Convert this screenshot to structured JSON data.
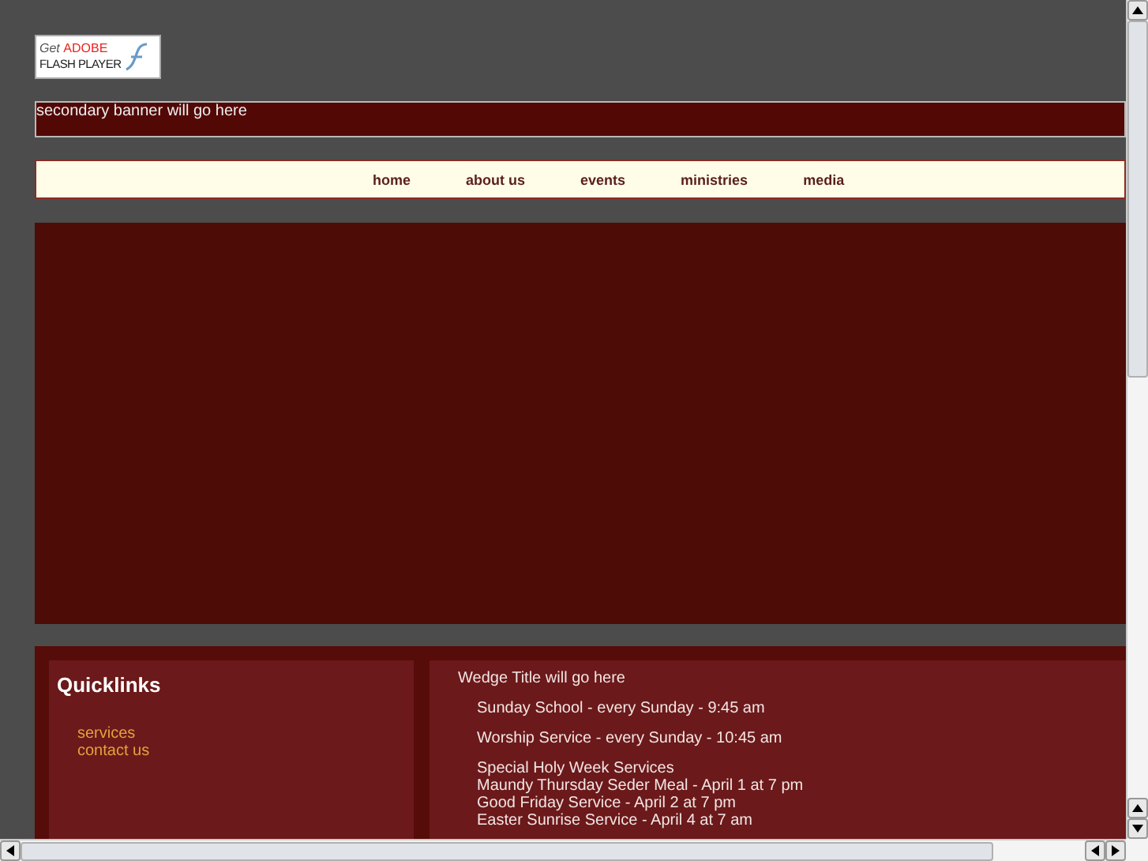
{
  "flash_badge": {
    "line_1_prefix": "Get",
    "line_1_brand": "ADOBE",
    "line_2": "FLASH PLAYER"
  },
  "secondary_banner": {
    "text": "secondary banner will go here"
  },
  "nav": [
    {
      "label": "home"
    },
    {
      "label": "about us"
    },
    {
      "label": "events"
    },
    {
      "label": "ministries"
    },
    {
      "label": "media"
    }
  ],
  "quicklinks": {
    "title": "Quicklinks",
    "links": [
      "services",
      "contact us"
    ]
  },
  "wedge": {
    "title": "Wedge Title will go here",
    "blocks": [
      [
        "Sunday School - every Sunday - 9:45 am"
      ],
      [
        "Worship Service - every Sunday - 10:45 am"
      ],
      [
        "Special Holy Week Services",
        "Maundy Thursday Seder Meal - April 1 at 7 pm",
        "Good Friday Service - April 2 at 7 pm",
        "Easter Sunrise Service - April 4 at 7 am"
      ]
    ]
  }
}
